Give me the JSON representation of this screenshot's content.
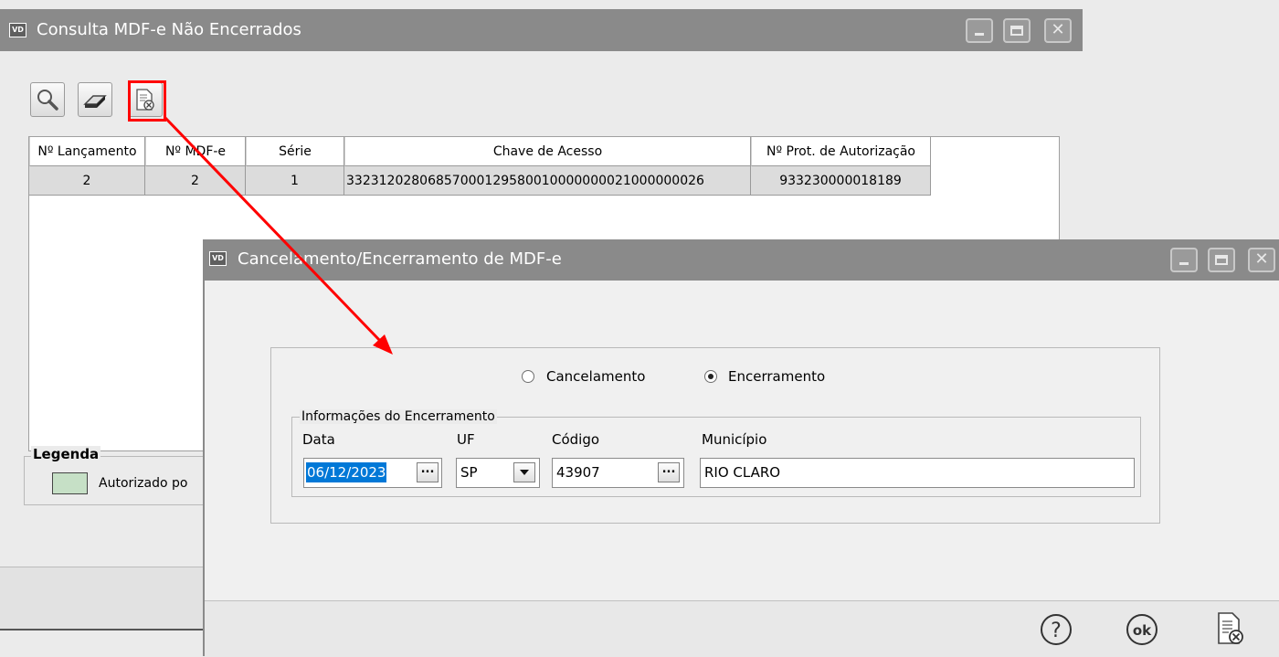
{
  "main_window": {
    "logo": "VD",
    "title": "Consulta MDF-e Não Encerrados",
    "grid": {
      "columns": [
        "Nº Lançamento",
        "Nº MDF-e",
        "Série",
        "Chave de Acesso",
        "Nº Prot. de Autorização"
      ],
      "rows": [
        [
          "2",
          "2",
          "1",
          "33231202806857000129580010000000021000000026",
          "933230000018189"
        ]
      ]
    },
    "legend": {
      "title": "Legenda",
      "items": [
        {
          "label": "Autorizado po",
          "color": "#c6e0c6"
        }
      ]
    },
    "toolbar_icons": [
      "search-icon",
      "eraser-icon",
      "cancel-document-icon"
    ]
  },
  "dialog": {
    "logo": "VD",
    "title": "Cancelamento/Encerramento de MDF-e",
    "radios": {
      "cancel_label": "Cancelamento",
      "close_label": "Encerramento",
      "selected": "Encerramento"
    },
    "group": {
      "title": "Informações do Encerramento",
      "data_label": "Data",
      "data_value": "06/12/2023",
      "uf_label": "UF",
      "uf_value": "SP",
      "codigo_label": "Código",
      "codigo_value": "43907",
      "municipio_label": "Município",
      "municipio_value": "RIO CLARO"
    },
    "footer_icons": [
      "help-icon",
      "ok-icon",
      "cancel-document-icon"
    ],
    "ok_text": "ok",
    "help_text": "?",
    "ellipsis": "...",
    "selection_color": "#0078d7"
  },
  "annotation": {
    "color": "#ff0000"
  }
}
